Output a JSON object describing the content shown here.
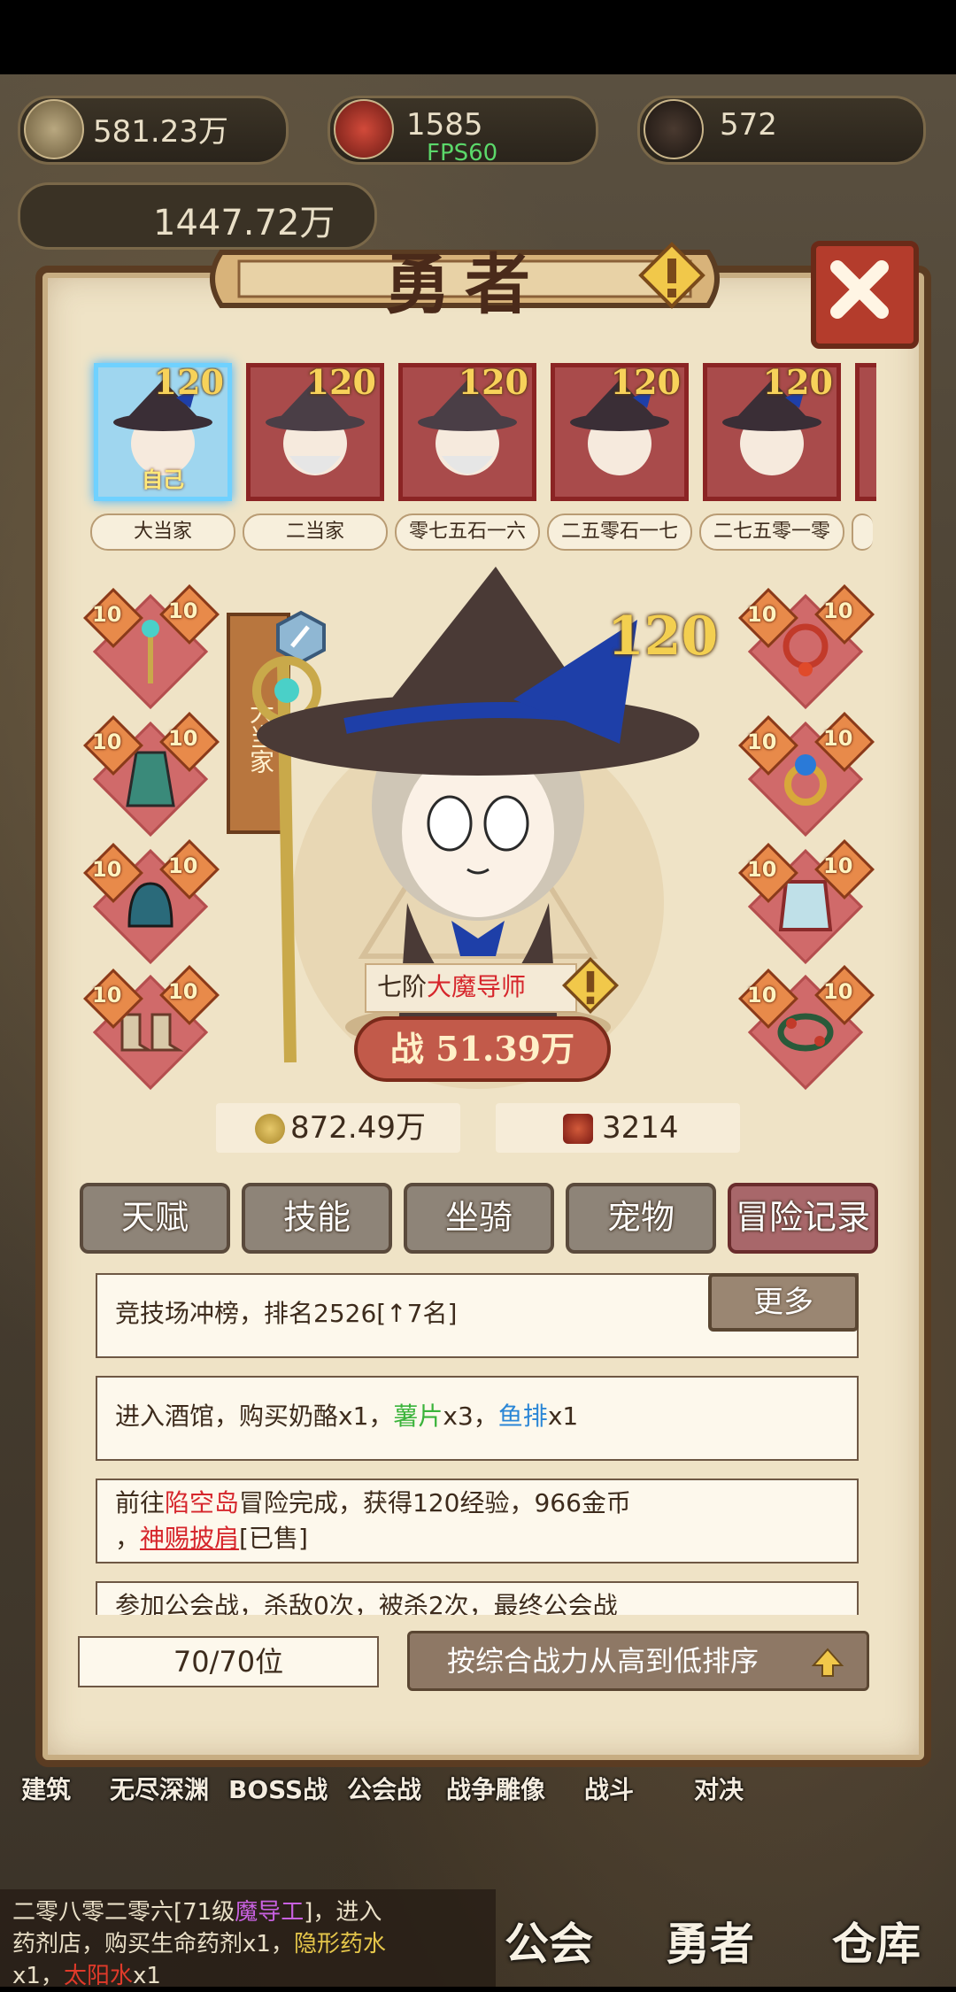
{
  "resources": {
    "gold": "581.23万",
    "arena_points": "1585",
    "dark_orb": "572",
    "fps": "FPS60",
    "guild_power": "1447.72万"
  },
  "panel": {
    "title": "勇者",
    "heroes": [
      {
        "name": "大当家",
        "level": "120",
        "self_label": "自己",
        "selected": true
      },
      {
        "name": "二当家",
        "level": "120"
      },
      {
        "name": "零七五石一六",
        "level": "120"
      },
      {
        "name": "二五零石一七",
        "level": "120"
      },
      {
        "name": "二七五零一零",
        "level": "120"
      }
    ],
    "equipment_level": "10",
    "hero_level": "120",
    "side_banner": "大当家",
    "class_prefix": "七阶",
    "class_name": "大魔导师",
    "power_label": "战",
    "power_value": "51.39万",
    "gold_stat": "872.49万",
    "medal_stat": "3214",
    "tabs": [
      "天赋",
      "技能",
      "坐骑",
      "宠物",
      "冒险记录"
    ],
    "more_button": "更多",
    "log": {
      "l1": "竞技场冲榜，排名2526[↑7名]",
      "l2_a": "进入酒馆，购买奶酪x1，",
      "l2_b": "薯片",
      "l2_c": "x3，",
      "l2_d": "鱼排",
      "l2_e": "x1",
      "l3_a": "前往",
      "l3_b": "陷空岛",
      "l3_c": "冒险完成，获得120经验，966金币",
      "l3_d": "，",
      "l3_e": "神赐披肩",
      "l3_f": "[已售]",
      "l4": "参加公会战，杀敌0次，被杀2次，最终公会战"
    },
    "slots": "70/70位",
    "sort_button": "按综合战力从高到低排序"
  },
  "bottom_nav": [
    "建筑",
    "无尽深渊",
    "BOSS战",
    "公会战",
    "战争雕像",
    "战斗",
    "对决"
  ],
  "chat": {
    "a": "二零八零二零六[71级",
    "b": "魔导工",
    "c": "]，进入",
    "d": "药剂店，购买生命药剂x1，",
    "e": "隐形药水",
    "f": "x1，",
    "g": "太阳水",
    "h": "x1"
  },
  "main_buttons": [
    "公会",
    "勇者",
    "仓库"
  ],
  "colors": {
    "accent_red": "#d6262c",
    "gold_text": "#f3cf50",
    "panel_bg": "#efe3c6"
  }
}
